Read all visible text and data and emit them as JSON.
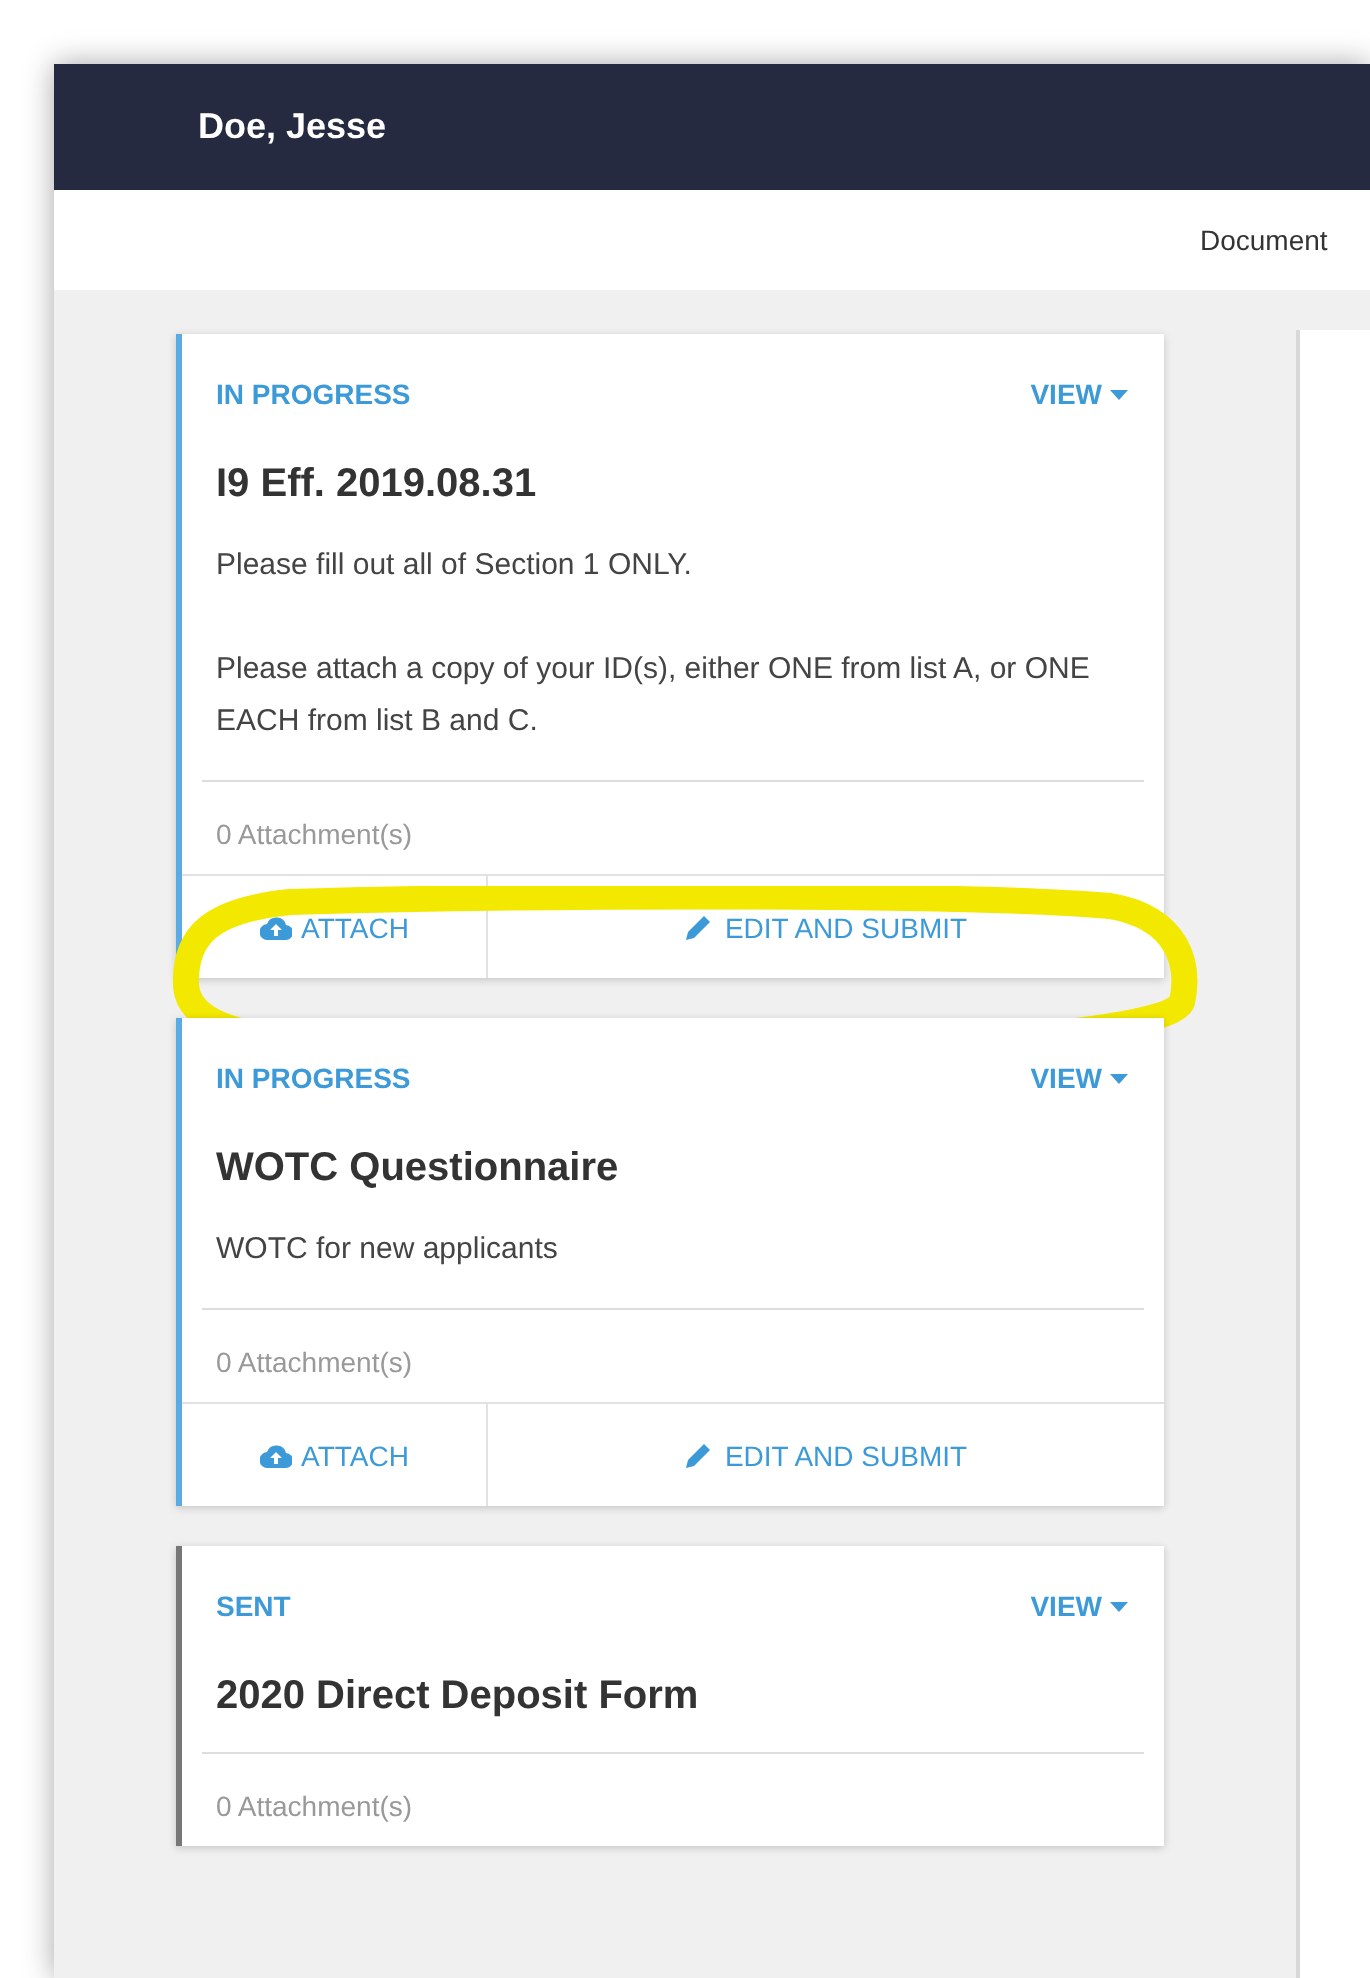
{
  "header": {
    "user_name": "Doe, Jesse"
  },
  "subheader": {
    "tab_label": "Document"
  },
  "cards": [
    {
      "kind": "in_progress",
      "status": "IN PROGRESS",
      "view_label": "VIEW",
      "title": "I9 Eff. 2019.08.31",
      "description": [
        "Please fill out all of Section 1 ONLY.",
        "Please attach a copy of your ID(s), either ONE from list A, or ONE EACH from list B and C."
      ],
      "attachments": "0 Attachment(s)",
      "actions": [
        {
          "kind": "attach",
          "label": "ATTACH"
        },
        {
          "kind": "edit",
          "label": "EDIT AND SUBMIT"
        }
      ],
      "highlighted": true
    },
    {
      "kind": "in_progress",
      "status": "IN PROGRESS",
      "view_label": "VIEW",
      "title": "WOTC Questionnaire",
      "description": [
        "WOTC for new applicants"
      ],
      "attachments": "0 Attachment(s)",
      "actions": [
        {
          "kind": "attach",
          "label": "ATTACH"
        },
        {
          "kind": "edit",
          "label": "EDIT AND SUBMIT"
        }
      ],
      "highlighted": false
    },
    {
      "kind": "sent",
      "status": "SENT",
      "view_label": "VIEW",
      "title": "2020 Direct Deposit Form",
      "attachments": "0 Attachment(s)",
      "highlighted": false
    }
  ]
}
